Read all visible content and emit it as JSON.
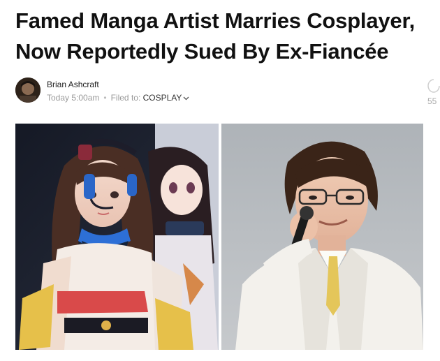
{
  "article": {
    "headline_line1": "Famed Manga Artist Marries Cosplayer,",
    "headline_line2": "Now Reportedly Sued By Ex-Fiancée"
  },
  "byline": {
    "author": "Brian Ashcraft",
    "timestamp": "Today 5:00am",
    "separator": "•",
    "filed_label": "Filed to:",
    "category": "COSPLAY"
  },
  "share": {
    "count": "55"
  },
  "colors": {
    "headline": "#111111",
    "meta_gray": "#9a9a9a",
    "background": "#ffffff"
  },
  "icons": {
    "category_dropdown": "chevron-down-icon",
    "share": "share-icon"
  }
}
